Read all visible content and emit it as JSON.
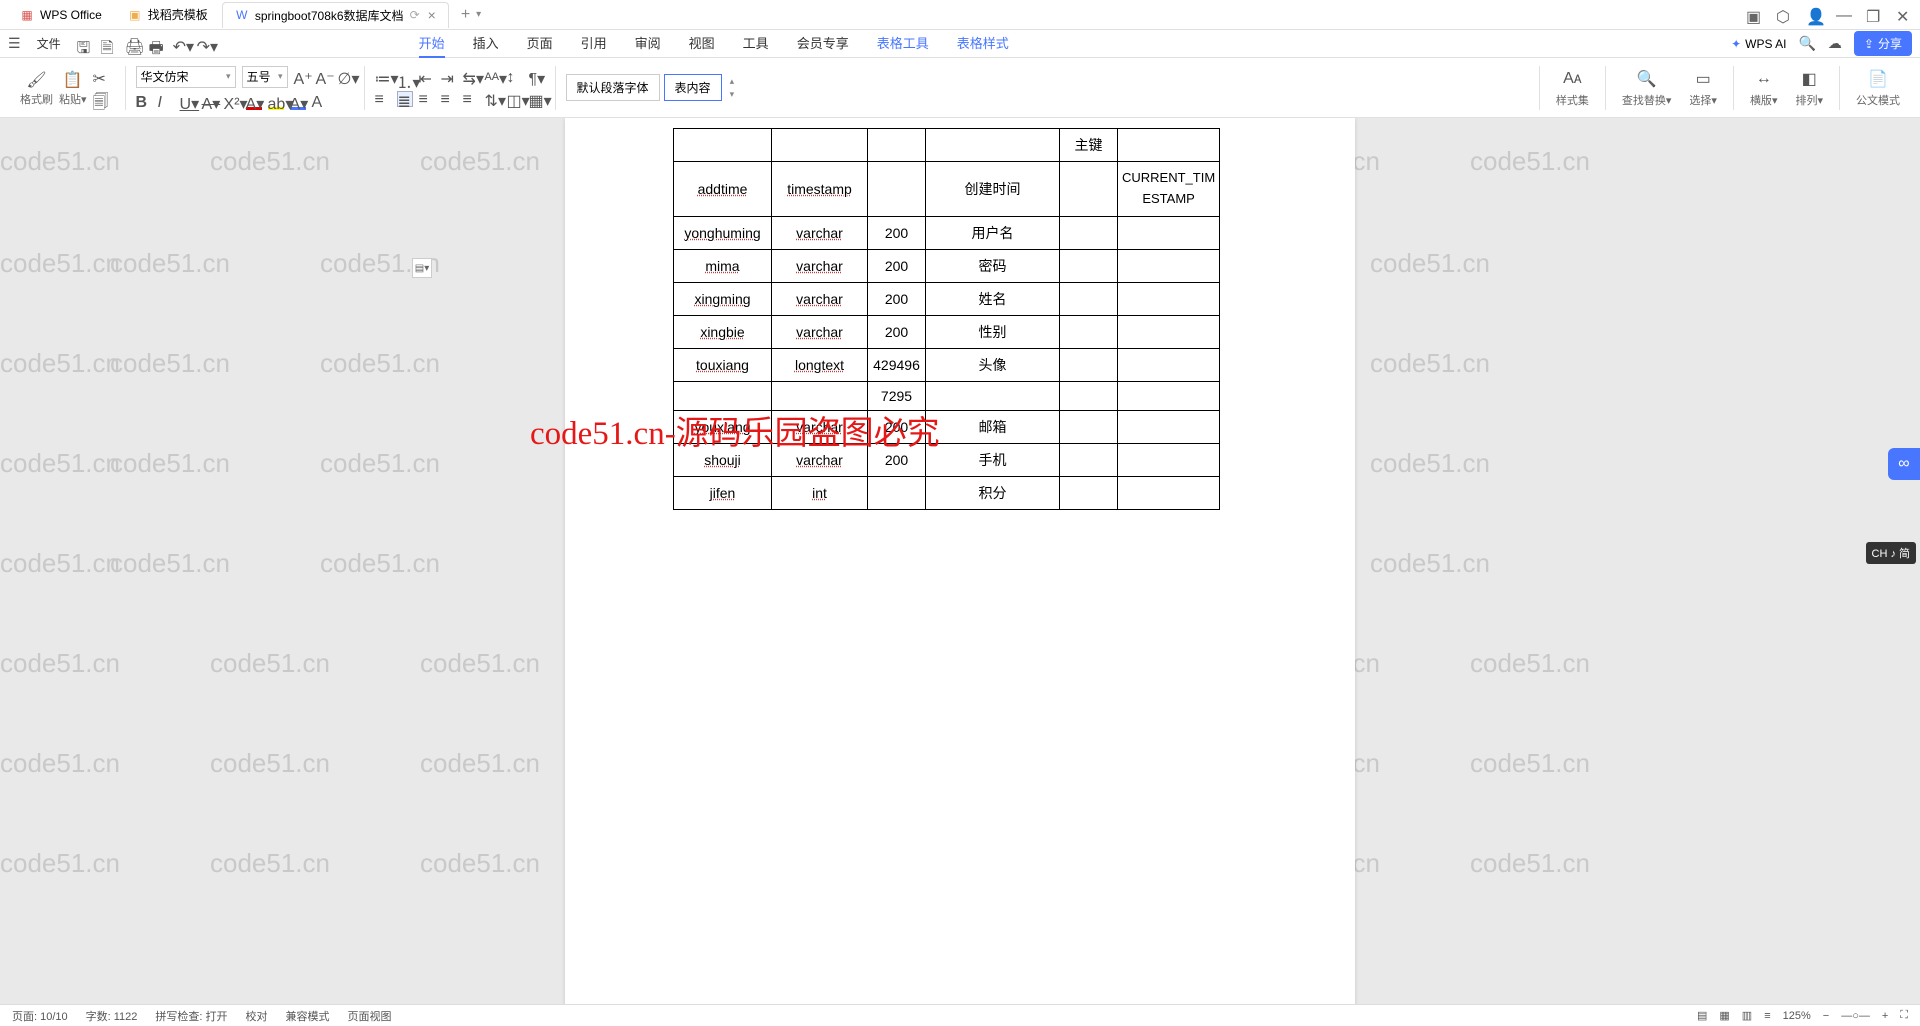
{
  "tabs": [
    {
      "label": "WPS Office",
      "icon": "W",
      "color": "#d9534f"
    },
    {
      "label": "找稻壳模板",
      "icon": "D",
      "color": "#f0ad4e"
    },
    {
      "label": "springboot708k6数据库文档",
      "icon": "W",
      "color": "#4876ff",
      "active": true
    }
  ],
  "file_menu": "文件",
  "main_tabs": {
    "start": "开始",
    "insert": "插入",
    "page": "页面",
    "ref": "引用",
    "review": "审阅",
    "view": "视图",
    "tools": "工具",
    "vip": "会员专享",
    "table_tool": "表格工具",
    "table_style": "表格样式"
  },
  "ai_label": "WPS AI",
  "share_label": "分享",
  "font": {
    "name": "华文仿宋",
    "size": "五号"
  },
  "style_default": "默认段落字体",
  "style_table": "表内容",
  "ribbon": {
    "fmt": "格式刷",
    "paste": "粘贴",
    "styles": "样式集",
    "find": "查找替换",
    "select": "选择",
    "hbreak": "横版",
    "arrange": "排列",
    "official": "公文模式"
  },
  "db_rows": [
    {
      "c1": "",
      "c2": "",
      "c3": "",
      "c4": "",
      "c5": "主键",
      "c6": ""
    },
    {
      "c1": "addtime",
      "c2": "timestamp",
      "c3": "",
      "c4": "创建时间",
      "c5": "",
      "c6": "CURRENT_TIMESTAMP"
    },
    {
      "c1": "yonghuming",
      "c2": "varchar",
      "c3": "200",
      "c4": "用户名",
      "c5": "",
      "c6": ""
    },
    {
      "c1": "mima",
      "c2": "varchar",
      "c3": "200",
      "c4": "密码",
      "c5": "",
      "c6": ""
    },
    {
      "c1": "xingming",
      "c2": "varchar",
      "c3": "200",
      "c4": "姓名",
      "c5": "",
      "c6": ""
    },
    {
      "c1": "xingbie",
      "c2": "varchar",
      "c3": "200",
      "c4": "性别",
      "c5": "",
      "c6": ""
    },
    {
      "c1": "touxiang",
      "c2": "longtext",
      "c3": "429496",
      "c4": "头像",
      "c5": "",
      "c6": ""
    },
    {
      "c1": "",
      "c2": "",
      "c3": "7295",
      "c4": "",
      "c5": "",
      "c6": ""
    },
    {
      "c1": "youxiang",
      "c2": "varchar",
      "c3": "200",
      "c4": "邮箱",
      "c5": "",
      "c6": ""
    },
    {
      "c1": "shouji",
      "c2": "varchar",
      "c3": "200",
      "c4": "手机",
      "c5": "",
      "c6": ""
    },
    {
      "c1": "jifen",
      "c2": "int",
      "c3": "",
      "c4": "积分",
      "c5": "",
      "c6": ""
    }
  ],
  "watermark_text": "code51.cn",
  "red_watermark": "code51.cn-源码乐园盗图必究",
  "status": {
    "page": "页面: 10/10",
    "words": "字数: 1122",
    "spell": "拼写检查: 打开",
    "proof": "校对",
    "compat": "兼容模式",
    "layout": "页面视图",
    "zoom": "125%"
  },
  "ime": "CH ♪ 简"
}
